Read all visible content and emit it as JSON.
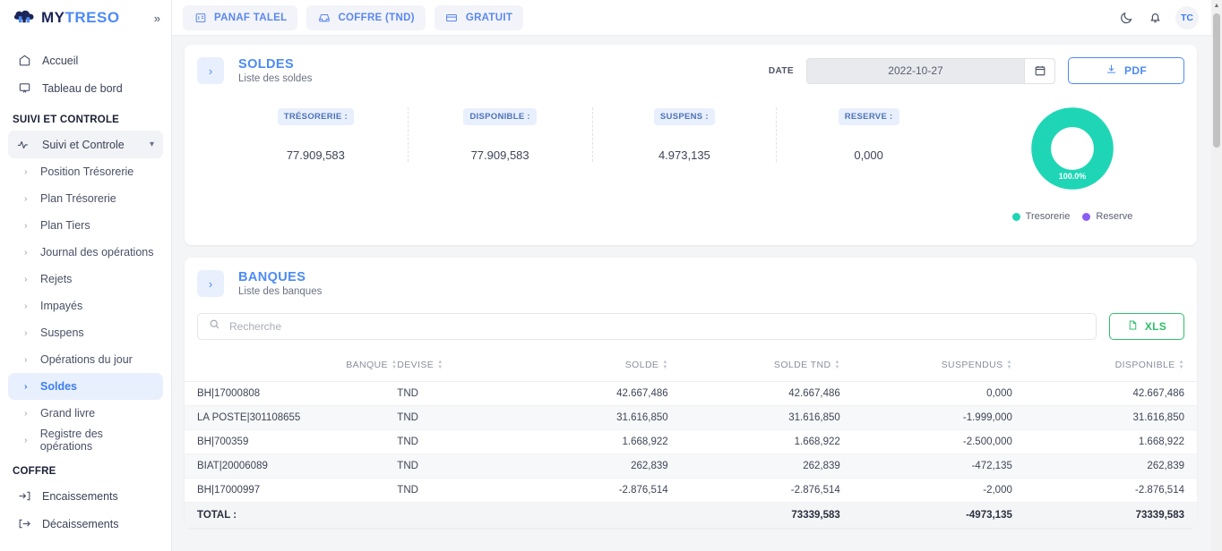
{
  "brand": {
    "part1": "MY",
    "part2": "TRESO",
    "expand_icon": "chevrons-right-icon"
  },
  "sidebar": {
    "top_items": [
      {
        "label": "Accueil",
        "icon": "home-icon"
      },
      {
        "label": "Tableau de bord",
        "icon": "dashboard-icon"
      }
    ],
    "section1_title": "SUIVI ET CONTROLE",
    "group_label": "Suivi et Controle",
    "sub_items": [
      {
        "label": "Position Trésorerie"
      },
      {
        "label": "Plan Trésorerie"
      },
      {
        "label": "Plan Tiers"
      },
      {
        "label": "Journal des opérations"
      },
      {
        "label": "Rejets"
      },
      {
        "label": "Impayés"
      },
      {
        "label": "Suspens"
      },
      {
        "label": "Opérations du jour"
      },
      {
        "label": "Soldes"
      },
      {
        "label": "Grand livre"
      },
      {
        "label": "Registre des opérations"
      }
    ],
    "active_sub": "Soldes",
    "section2_title": "COFFRE",
    "coffre_items": [
      {
        "label": "Encaissements",
        "icon": "arrow-into-bracket-icon"
      },
      {
        "label": "Décaissements",
        "icon": "arrow-out-bracket-icon"
      }
    ]
  },
  "topbar": {
    "tabs": [
      {
        "label": "PANAF TALEL",
        "icon": "company-icon"
      },
      {
        "label": "COFFRE (TND)",
        "icon": "inbox-icon"
      },
      {
        "label": "GRATUIT",
        "icon": "card-icon"
      }
    ],
    "theme_icon": "moon-icon",
    "bell_icon": "bell-icon",
    "avatar_initials": "TC"
  },
  "soldes": {
    "title": "SOLDES",
    "subtitle": "Liste des soldes",
    "expand_icon": "chevron-right-icon",
    "date_label": "DATE",
    "date_value": "2022-10-27",
    "calendar_icon": "calendar-icon",
    "pdf_button": "PDF",
    "pdf_icon": "download-icon",
    "kpis": [
      {
        "tag": "TRÉSORERIE :",
        "value": "77.909,583"
      },
      {
        "tag": "DISPONIBLE :",
        "value": "77.909,583"
      },
      {
        "tag": "SUSPENS :",
        "value": "4.973,135"
      },
      {
        "tag": "RESERVE :",
        "value": "0,000"
      }
    ]
  },
  "chart_data": {
    "type": "pie",
    "title": "",
    "labels": [
      "Tresorerie",
      "Reserve"
    ],
    "values": [
      100.0,
      0.0
    ],
    "value_labels": [
      "100.0%",
      ""
    ],
    "colors": [
      "#1ed6b5",
      "#8b5cf6"
    ],
    "legend_position": "bottom",
    "donut": true
  },
  "banques": {
    "title": "BANQUES",
    "subtitle": "Liste des banques",
    "expand_icon": "chevron-right-icon",
    "search_placeholder": "Recherche",
    "search_value": "",
    "search_icon": "search-icon",
    "xls_button": "XLS",
    "xls_icon": "file-icon",
    "columns": [
      "BANQUE",
      "DEVISE",
      "SOLDE",
      "SOLDE TND",
      "SUSPENDUS",
      "DISPONIBLE"
    ],
    "rows": [
      {
        "banque": "BH|17000808",
        "devise": "TND",
        "solde": "42.667,486",
        "solde_tnd": "42.667,486",
        "suspendus": "0,000",
        "disponible": "42.667,486"
      },
      {
        "banque": "LA POSTE|301108655",
        "devise": "TND",
        "solde": "31.616,850",
        "solde_tnd": "31.616,850",
        "suspendus": "-1.999,000",
        "disponible": "31.616,850"
      },
      {
        "banque": "BH|700359",
        "devise": "TND",
        "solde": "1.668,922",
        "solde_tnd": "1.668,922",
        "suspendus": "-2.500,000",
        "disponible": "1.668,922"
      },
      {
        "banque": "BIAT|20006089",
        "devise": "TND",
        "solde": "262,839",
        "solde_tnd": "262,839",
        "suspendus": "-472,135",
        "disponible": "262,839"
      },
      {
        "banque": "BH|17000997",
        "devise": "TND",
        "solde": "-2.876,514",
        "solde_tnd": "-2.876,514",
        "suspendus": "-2,000",
        "disponible": "-2.876,514"
      }
    ],
    "total": {
      "label": "TOTAL :",
      "devise": "",
      "solde": "",
      "solde_tnd": "73339,583",
      "suspendus": "-4973,135",
      "disponible": "73339,583"
    }
  },
  "colors": {
    "accent": "#4d8bf5",
    "teal": "#1ed6b5",
    "purple": "#8b5cf6",
    "green": "#2fbf6c"
  }
}
